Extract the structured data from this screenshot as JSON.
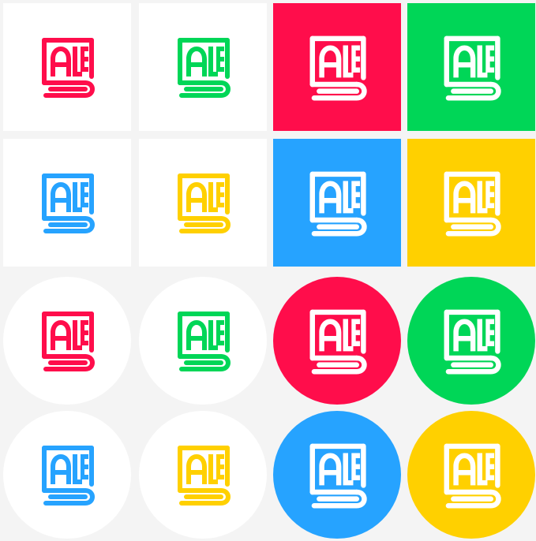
{
  "colors": {
    "page_background": "#f4f4f4",
    "white": "#ffffff",
    "red": "#ff0d4b",
    "green": "#00d657",
    "blue": "#26a3ff",
    "yellow": "#ffd000"
  },
  "logo": {
    "name": "logo-mark",
    "text": "ALE"
  },
  "tiles": [
    {
      "shape": "square",
      "background": "white",
      "mark_color": "red"
    },
    {
      "shape": "square",
      "background": "white",
      "mark_color": "green"
    },
    {
      "shape": "square",
      "background": "red",
      "mark_color": "white"
    },
    {
      "shape": "square",
      "background": "green",
      "mark_color": "white"
    },
    {
      "shape": "square",
      "background": "white",
      "mark_color": "blue"
    },
    {
      "shape": "square",
      "background": "white",
      "mark_color": "yellow"
    },
    {
      "shape": "square",
      "background": "blue",
      "mark_color": "white"
    },
    {
      "shape": "square",
      "background": "yellow",
      "mark_color": "white"
    },
    {
      "shape": "circle",
      "background": "white",
      "mark_color": "red"
    },
    {
      "shape": "circle",
      "background": "white",
      "mark_color": "green"
    },
    {
      "shape": "circle",
      "background": "red",
      "mark_color": "white"
    },
    {
      "shape": "circle",
      "background": "green",
      "mark_color": "white"
    },
    {
      "shape": "circle",
      "background": "white",
      "mark_color": "blue"
    },
    {
      "shape": "circle",
      "background": "white",
      "mark_color": "yellow"
    },
    {
      "shape": "circle",
      "background": "blue",
      "mark_color": "white"
    },
    {
      "shape": "circle",
      "background": "yellow",
      "mark_color": "white"
    }
  ]
}
